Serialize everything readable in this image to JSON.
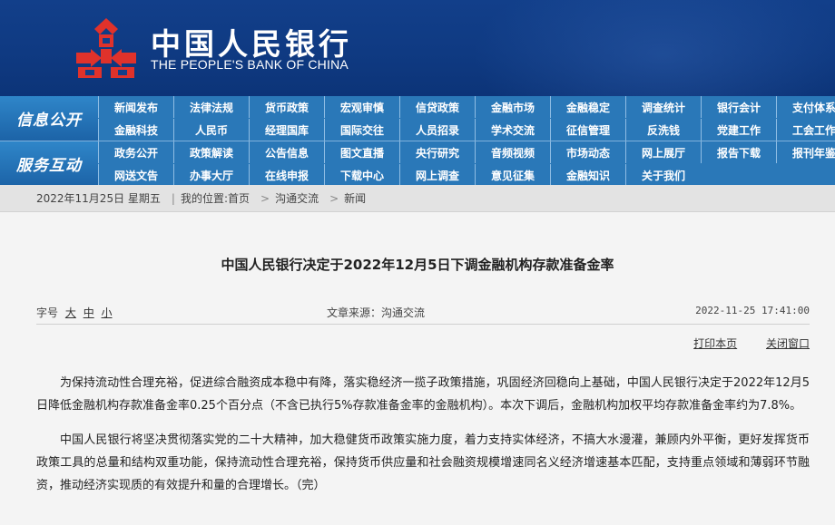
{
  "header": {
    "cn_name": "中国人民银行",
    "en_name": "THE PEOPLE'S BANK OF CHINA",
    "logo_color": "#e0322b",
    "bg_color": "#123f8a"
  },
  "nav": {
    "info_label": "信息公开",
    "service_label": "服务互动",
    "info_rows": [
      [
        "新闻发布",
        "法律法规",
        "货币政策",
        "宏观审慎",
        "信贷政策",
        "金融市场",
        "金融稳定",
        "调查统计",
        "银行会计",
        "支付体系"
      ],
      [
        "金融科技",
        "人民币",
        "经理国库",
        "国际交往",
        "人员招录",
        "学术交流",
        "征信管理",
        "反洗钱",
        "党建工作",
        "工会工作"
      ]
    ],
    "service_rows": [
      [
        "政务公开",
        "政策解读",
        "公告信息",
        "图文直播",
        "央行研究",
        "音频视频",
        "市场动态",
        "网上展厅",
        "报告下载",
        "报刊年鉴"
      ],
      [
        "网送文告",
        "办事大厅",
        "在线申报",
        "下载中心",
        "网上调查",
        "意见征集",
        "金融知识",
        "关于我们"
      ]
    ]
  },
  "breadcrumb": {
    "date": "2022年11月25日 星期五",
    "location_label": "我的位置:首页",
    "level1": "沟通交流",
    "level2": "新闻"
  },
  "article": {
    "title": "中国人民银行决定于2022年12月5日下调金融机构存款准备金率",
    "font_size_label": "字号",
    "size_large": "大",
    "size_medium": "中",
    "size_small": "小",
    "source": "文章来源：沟通交流",
    "time": "2022-11-25 17:41:00",
    "print_label": "打印本页",
    "close_label": "关闭窗口",
    "paragraphs": [
      "为保持流动性合理充裕，促进综合融资成本稳中有降，落实稳经济一揽子政策措施，巩固经济回稳向上基础，中国人民银行决定于2022年12月5日降低金融机构存款准备金率0.25个百分点（不含已执行5%存款准备金率的金融机构）。本次下调后，金融机构加权平均存款准备金率约为7.8%。",
      "中国人民银行将坚决贯彻落实党的二十大精神，加大稳健货币政策实施力度，着力支持实体经济，不搞大水漫灌，兼顾内外平衡，更好发挥货币政策工具的总量和结构双重功能，保持流动性合理充裕，保持货币供应量和社会融资规模增速同名义经济增速基本匹配，支持重点领域和薄弱环节融资，推动经济实现质的有效提升和量的合理增长。（完）"
    ]
  }
}
